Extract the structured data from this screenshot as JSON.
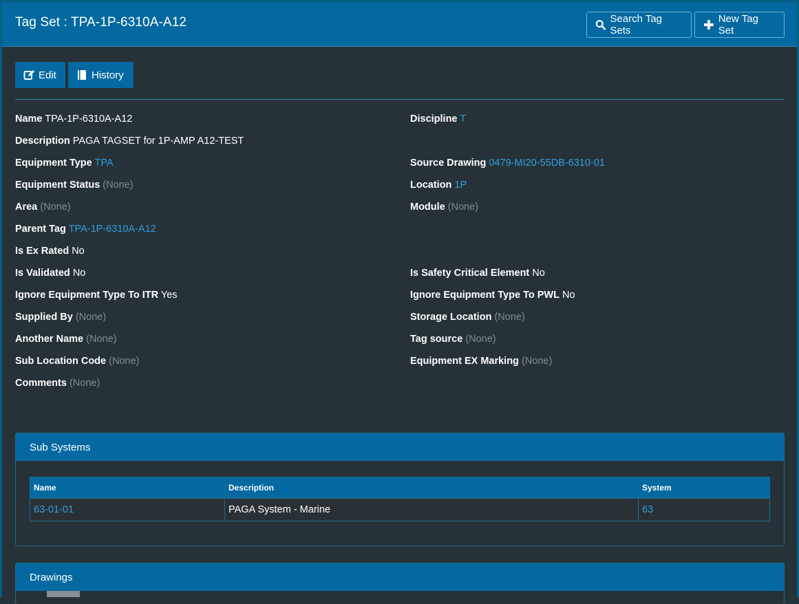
{
  "header": {
    "title": "Tag Set : TPA-1P-6310A-A12",
    "search_label": "Search Tag Sets",
    "new_label": "New Tag Set"
  },
  "actions": {
    "edit_label": "Edit",
    "history_label": "History"
  },
  "fields_left": [
    {
      "label": "Name",
      "value": "TPA-1P-6310A-A12",
      "style": "plain"
    },
    {
      "label": "Description",
      "value": "PAGA TAGSET for 1P-AMP A12-TEST",
      "style": "plain"
    },
    {
      "label": "Equipment Type",
      "value": "TPA",
      "style": "link"
    },
    {
      "label": "Equipment Status",
      "value": "(None)",
      "style": "none"
    },
    {
      "label": "Area",
      "value": "(None)",
      "style": "none"
    },
    {
      "label": "Parent Tag",
      "value": "TPA-1P-6310A-A12",
      "style": "link"
    },
    {
      "label": "Is Ex Rated",
      "value": "No",
      "style": "plain"
    },
    {
      "label": "Is Validated",
      "value": "No",
      "style": "plain"
    },
    {
      "label": "Ignore Equipment Type To ITR",
      "value": "Yes",
      "style": "plain"
    },
    {
      "label": "Supplied By",
      "value": "(None)",
      "style": "none"
    },
    {
      "label": "Another Name",
      "value": "(None)",
      "style": "none"
    },
    {
      "label": "Sub Location Code",
      "value": "(None)",
      "style": "none"
    },
    {
      "label": "Comments",
      "value": "(None)",
      "style": "none"
    }
  ],
  "fields_right": [
    {
      "label": "Discipline",
      "value": "T",
      "style": "link"
    },
    {
      "label": "Source Drawing",
      "value": "0479-MI20-55DB-6310-01",
      "style": "link"
    },
    {
      "label": "Location",
      "value": "1P",
      "style": "link"
    },
    {
      "label": "Module",
      "value": "(None)",
      "style": "none"
    },
    {
      "label": "Is Safety Critical Element",
      "value": "No",
      "style": "plain"
    },
    {
      "label": "Ignore Equipment Type To PWL",
      "value": "No",
      "style": "plain"
    },
    {
      "label": "Storage Location",
      "value": "(None)",
      "style": "none"
    },
    {
      "label": "Tag source",
      "value": "(None)",
      "style": "none"
    },
    {
      "label": "Equipment EX Marking",
      "value": "(None)",
      "style": "none"
    }
  ],
  "sub_systems": {
    "title": "Sub Systems",
    "columns": [
      "Name",
      "Description",
      "System"
    ],
    "rows": [
      {
        "name": "63-01-01",
        "description": "PAGA System - Marine",
        "system": "63"
      }
    ]
  },
  "drawings": {
    "title": "Drawings"
  }
}
